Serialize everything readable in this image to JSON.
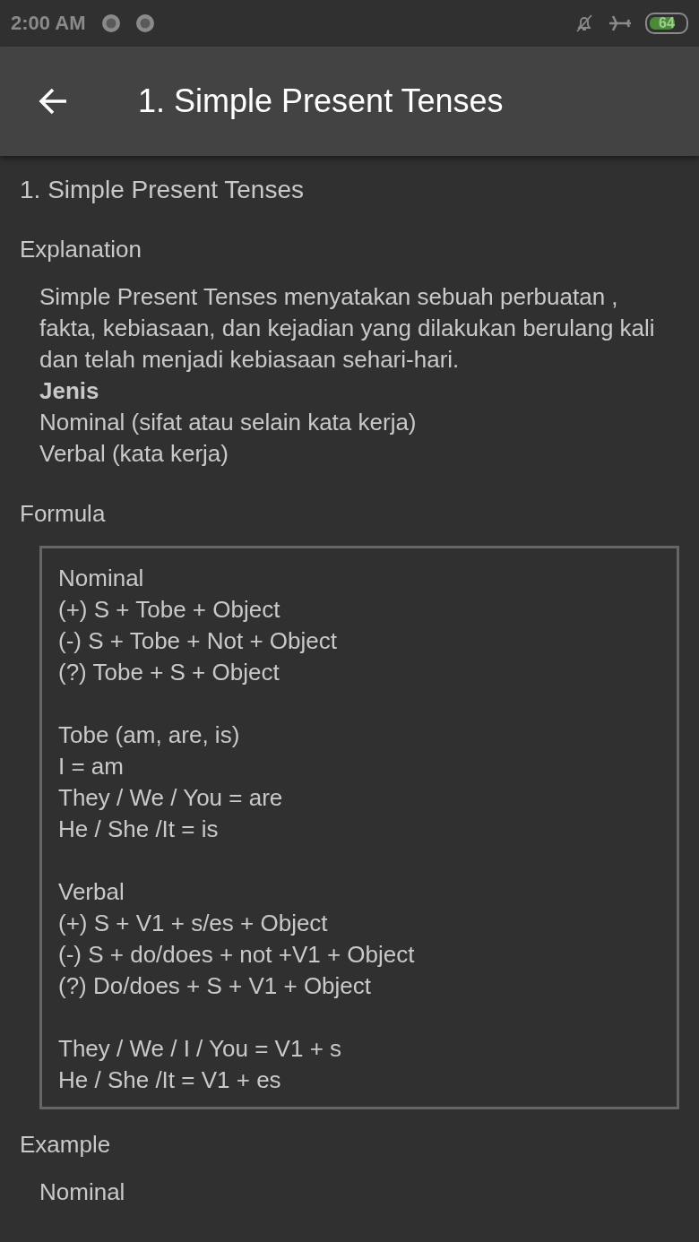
{
  "status_bar": {
    "time": "2:00 AM",
    "battery": "64"
  },
  "app_bar": {
    "title": "1. Simple Present Tenses"
  },
  "content": {
    "heading": "1. Simple Present Tenses",
    "explanation": {
      "label": "Explanation",
      "text": "Simple Present Tenses menyatakan sebuah perbuatan , fakta, kebiasaan, dan kejadian yang dilakukan berulang kali dan telah menjadi kebiasaan sehari-hari.",
      "types_heading": "Jenis",
      "types": [
        "Nominal (sifat atau selain kata kerja)",
        "Verbal (kata kerja)"
      ]
    },
    "formula": {
      "label": "Formula",
      "groups": [
        [
          "Nominal",
          "(+) S + Tobe + Object",
          "(-) S + Tobe + Not + Object",
          "(?) Tobe + S + Object"
        ],
        [
          "Tobe (am, are, is)",
          "I = am",
          "They / We / You = are",
          "He / She /It = is"
        ],
        [
          "Verbal",
          "(+) S + V1 + s/es + Object",
          "(-) S + do/does + not +V1 + Object",
          "(?) Do/does + S + V1 + Object"
        ],
        [
          "They / We / I / You = V1 + s",
          "He / She /It = V1 + es"
        ]
      ]
    },
    "example": {
      "label": "Example",
      "items": [
        "Nominal"
      ]
    }
  }
}
